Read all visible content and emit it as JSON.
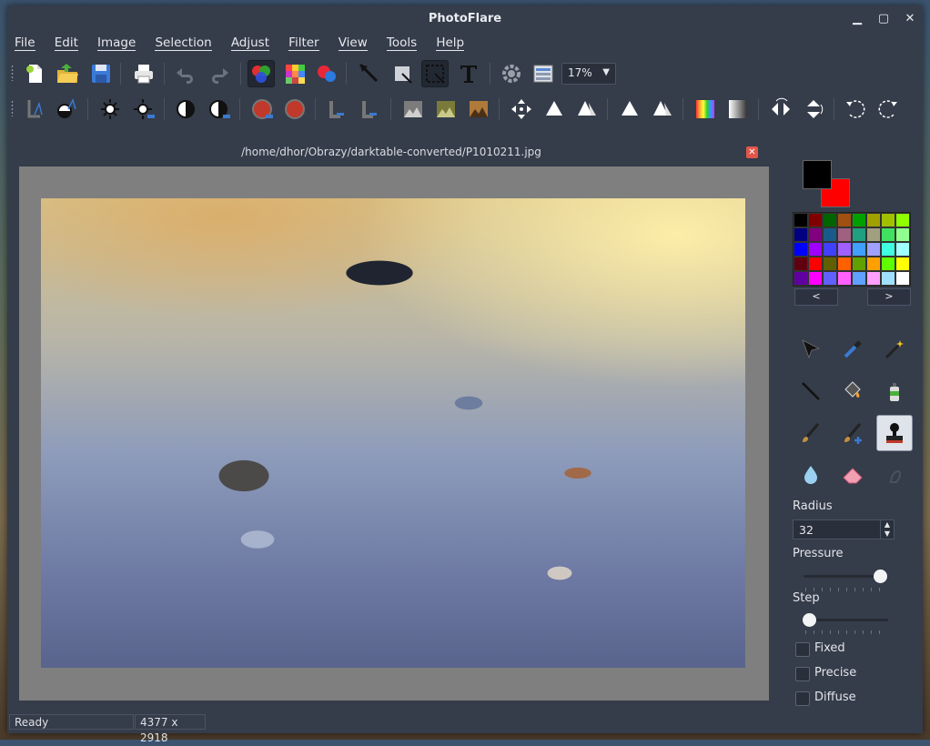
{
  "window": {
    "title": "PhotoFlare",
    "minimize": "▁",
    "maximize": "▢",
    "close": "✕"
  },
  "menu": [
    "File",
    "Edit",
    "Image",
    "Selection",
    "Adjust",
    "Filter",
    "View",
    "Tools",
    "Help"
  ],
  "toolbar1": {
    "icons": [
      "new-file-icon",
      "open-folder-icon",
      "save-icon",
      "print-icon",
      "undo-icon",
      "redo-icon",
      "color-circles-icon",
      "color-grid-icon",
      "red-blue-circles-icon",
      "pointer-tool-icon",
      "crop-icon",
      "select-rectangle-icon",
      "text-tool-icon",
      "settings-icon",
      "layers-icon"
    ],
    "zoom": "17%"
  },
  "toolbar2": {
    "icons": [
      "flip-text-icon",
      "auto-level-icon",
      "brightness-up-icon",
      "brightness-down-icon",
      "contrast-up-icon",
      "contrast-down-icon",
      "hue-up-icon",
      "hue-down-icon",
      "level-left-icon",
      "level-right-icon",
      "picture-grey-icon",
      "picture-olive-icon",
      "picture-brown-icon",
      "move-arrows-icon",
      "triangle-icon",
      "triangles-icon",
      "triangle-single-icon",
      "triangle-pair-icon",
      "rainbow-icon",
      "gradient-icon",
      "flip-horizontal-icon",
      "flip-vertical-icon",
      "rotate-left-icon",
      "rotate-right-icon"
    ]
  },
  "document": {
    "path": "/home/dhor/Obrazy/darktable-converted/P1010211.jpg",
    "close": "✕"
  },
  "colors": {
    "foreground": "#000000",
    "background": "#ff0000",
    "palette": [
      "#000000",
      "#800000",
      "#006400",
      "#a05010",
      "#00a000",
      "#a0a000",
      "#a0c000",
      "#90ff00",
      "#000080",
      "#800080",
      "#1a5a8a",
      "#a06080",
      "#20a080",
      "#a0a080",
      "#40e060",
      "#90ff90",
      "#0000ff",
      "#a000ff",
      "#4040ff",
      "#a060ff",
      "#40a0ff",
      "#a0a0ff",
      "#40ffe0",
      "#a0ffff",
      "#600010",
      "#ff0000",
      "#606000",
      "#ff6000",
      "#60a000",
      "#ffa000",
      "#60ff00",
      "#ffff00",
      "#6000a0",
      "#ff00ff",
      "#6060ff",
      "#ff60ff",
      "#60a0ff",
      "#ffa0ff",
      "#a0e0ff",
      "#ffffff"
    ],
    "prev": "<",
    "next": ">"
  },
  "tools": [
    "arrow-tool-icon",
    "eyedropper-icon",
    "magic-wand-icon",
    "line-tool-icon",
    "paint-bucket-icon",
    "spray-can-icon",
    "paintbrush-icon",
    "paintbrush-plus-icon",
    "stamp-tool-icon",
    "blur-drop-icon",
    "eraser-icon",
    "smudge-icon"
  ],
  "brush": {
    "radius_label": "Radius",
    "radius_value": "32",
    "pressure_label": "Pressure",
    "pressure_value": 1.0,
    "step_label": "Step",
    "step_value": 0.0,
    "fixed_label": "Fixed",
    "precise_label": "Precise",
    "diffuse_label": "Diffuse"
  },
  "status": {
    "message": "Ready",
    "dimensions": "4377 x 2918"
  }
}
